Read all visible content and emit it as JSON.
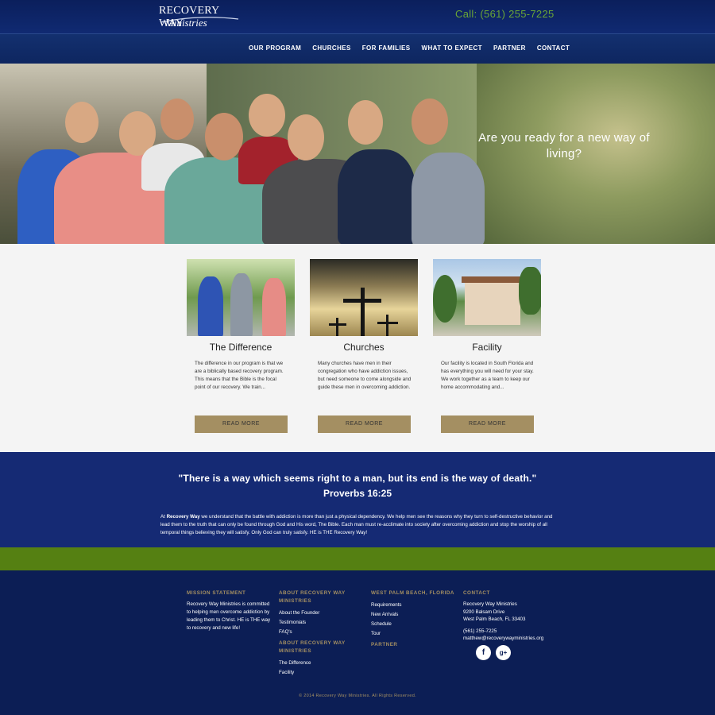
{
  "header": {
    "logo_main": "RECOVERY WAY",
    "logo_sub": "Ministries",
    "phone": "Call: (561) 255-7225"
  },
  "nav": {
    "items": [
      "OUR PROGRAM",
      "CHURCHES",
      "FOR FAMILIES",
      "WHAT TO EXPECT",
      "PARTNER",
      "CONTACT"
    ]
  },
  "hero": {
    "tagline": "Are you ready for a new way of living?"
  },
  "cards": [
    {
      "title": "The Difference",
      "text": "The difference in our program is that we are a biblically based recovery program. This means that the Bible is the focal point of our recovery. We train...",
      "button": "READ MORE"
    },
    {
      "title": "Churches",
      "text": "Many churches have men in their congregation who have addiction issues, but need someone to come alongside and guide these men in overcoming addiction.",
      "button": "READ MORE"
    },
    {
      "title": "Facility",
      "text": "Our facility is located in South Florida and has everything you will need for your stay. We work together as a team to keep our home accommodating and...",
      "button": "READ MORE"
    }
  ],
  "quote": {
    "line": "\"There is a way which seems right to a man, but its end is the way of death.\"",
    "reference": "Proverbs 16:25",
    "para_prefix": "At ",
    "para_bold": "Recovery Way",
    "para_rest": " we understand that the battle with addiction is more than just a physical dependency. We help men see the reasons why they turn to self-destructive behavior and lead them to the truth that can only be found through God and His word, The Bible. Each man must re-acclimate into society after overcoming addiction and stop the worship of all temporal things believing they will satisfy. Only God can truly satisfy. HE is THE Recovery Way!"
  },
  "footer": {
    "mission_heading": "MISSION STATEMENT",
    "mission_text": "Recovery Way Ministries is committed to helping men overcome addiction by leading them to Christ. HE is THE way to recovery and new life!",
    "about_heading": "ABOUT RECOVERY WAY MINISTRIES",
    "about_items": [
      "About the Founder",
      "Testimonials",
      "FAQ's"
    ],
    "about2_heading": "ABOUT RECOVERY WAY MINISTRIES",
    "about2_items": [
      "The Difference",
      "Facility"
    ],
    "wpb_heading": "WEST PALM BEACH, FLORIDA",
    "wpb_items": [
      "Requirements",
      "New Arrivals",
      "Schedule",
      "Tour"
    ],
    "partner_heading": "PARTNER",
    "contact_heading": "CONTACT",
    "contact_name": "Recovery Way Ministries",
    "contact_street": "9200 Balsam Drive",
    "contact_city": "West Palm Beach, FL 33403",
    "contact_phone": "(561) 255-7225",
    "contact_email": "matthew@recoverywayministries.org",
    "social_icons": [
      "facebook-icon",
      "google-plus-icon"
    ],
    "copyright": "© 2014 Recovery Way Ministries. All Rights Reserved."
  }
}
